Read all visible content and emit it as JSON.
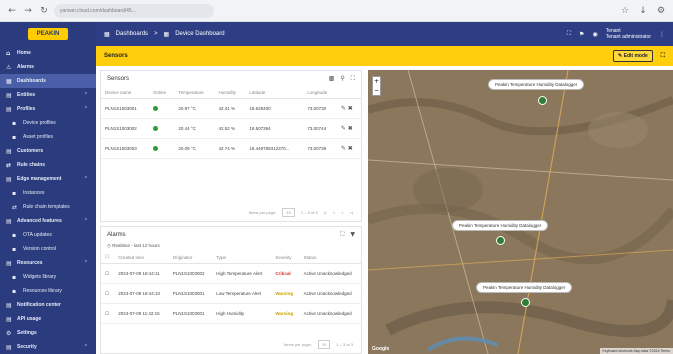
{
  "browser": {
    "url": "yanwei.cloud.com/dashboard/45...",
    "nav": [
      "←",
      "→",
      "↻"
    ],
    "right_icons": [
      "☆",
      "↓",
      "⚙"
    ]
  },
  "sidebar": {
    "logo": "PEAKIN",
    "items": [
      {
        "label": "Home",
        "icon": "⌂",
        "type": "top"
      },
      {
        "label": "Alarms",
        "icon": "⚠",
        "type": "top"
      },
      {
        "label": "Dashboards",
        "icon": "▦",
        "type": "active"
      },
      {
        "label": "Entities",
        "icon": "▤",
        "type": "top",
        "chev": "⌃"
      },
      {
        "label": "Profiles",
        "icon": "▤",
        "type": "top",
        "chev": "⌃"
      },
      {
        "label": "Device profiles",
        "icon": "▪",
        "type": "sub"
      },
      {
        "label": "Asset profiles",
        "icon": "▪",
        "type": "sub"
      },
      {
        "label": "Customers",
        "icon": "▤",
        "type": "top"
      },
      {
        "label": "Rule chains",
        "icon": "⇄",
        "type": "top"
      },
      {
        "label": "Edge management",
        "icon": "▤",
        "type": "top",
        "chev": "⌃"
      },
      {
        "label": "Instances",
        "icon": "▪",
        "type": "sub"
      },
      {
        "label": "Rule chain templates",
        "icon": "⇄",
        "type": "sub"
      },
      {
        "label": "Advanced features",
        "icon": "▤",
        "type": "top",
        "chev": "⌃"
      },
      {
        "label": "OTA updates",
        "icon": "▪",
        "type": "sub"
      },
      {
        "label": "Version control",
        "icon": "▪",
        "type": "sub"
      },
      {
        "label": "Resources",
        "icon": "▤",
        "type": "top",
        "chev": "⌃"
      },
      {
        "label": "Widgets library",
        "icon": "▪",
        "type": "sub"
      },
      {
        "label": "Resources library",
        "icon": "▪",
        "type": "sub"
      },
      {
        "label": "Notification center",
        "icon": "▤",
        "type": "top"
      },
      {
        "label": "API usage",
        "icon": "▤",
        "type": "top"
      },
      {
        "label": "Settings",
        "icon": "⚙",
        "type": "top"
      },
      {
        "label": "Security",
        "icon": "▤",
        "type": "top",
        "chev": "⌃"
      }
    ]
  },
  "topbar": {
    "crumb1": "Dashboards",
    "sep": ">",
    "crumb2": "Device Dashboard",
    "user_name": "Tenant",
    "user_role": "Tenant administrator"
  },
  "yellowbar": {
    "title": "Sensors",
    "edit": "✎ Edit mode"
  },
  "sensors": {
    "title": "Sensors",
    "columns": [
      "Device name",
      "Online",
      "Temperature",
      "Humidity",
      "Latitude",
      "Longitude"
    ],
    "rows": [
      {
        "name": "PLN1S1003001",
        "temp": "20.97 °C",
        "hum": "42.41 %",
        "lat": "18.628400",
        "lon": "73.00730"
      },
      {
        "name": "PLN1S1003002",
        "temp": "20.44 °C",
        "hum": "42.52 %",
        "lat": "18.507394",
        "lon": "73.00744"
      },
      {
        "name": "PLN1S1003003",
        "temp": "20.09 °C",
        "hum": "42.74 %",
        "lat": "18.449788312370...",
        "lon": "73.00739"
      }
    ],
    "pager_label": "Items per page:",
    "pager_value": "10",
    "pager_range": "1 – 3 of 3"
  },
  "alarms": {
    "title": "Alarms",
    "filter": "Realtime - last 12 hours",
    "columns": [
      "Created time",
      "Originator",
      "Type",
      "Severity",
      "Status"
    ],
    "rows": [
      {
        "time": "2024-07-09 18:44:11",
        "orig": "PLN1S1003002",
        "type": "High Temperature Alert",
        "sev": "Critical",
        "sevclass": "sev-red",
        "status": "Active Unacknowledged"
      },
      {
        "time": "2024-07-09 18:44:10",
        "orig": "PLN1S1003001",
        "type": "Low Temperature Alert",
        "sev": "Warning",
        "sevclass": "sev-yel",
        "status": "Active Unacknowledged"
      },
      {
        "time": "2024-07-09 11:42:15",
        "orig": "PLN1S1003001",
        "type": "High Humidity",
        "sev": "Warning",
        "sevclass": "sev-yel",
        "status": "Active Unacknowledged"
      }
    ],
    "pager_label": "Items per page:",
    "pager_value": "10",
    "pager_range": "1 – 3 of 3"
  },
  "map": {
    "labels": [
      "Peakin Temperature Humidity Datalogger",
      "Peakin Temperature Humidity Datalogger",
      "Peakin Temperature Humidity Datalogger"
    ],
    "zoom_in": "+",
    "zoom_out": "−",
    "attribution": "Keyboard shortcuts  Map data ©2024  Terms",
    "google": "Google"
  }
}
